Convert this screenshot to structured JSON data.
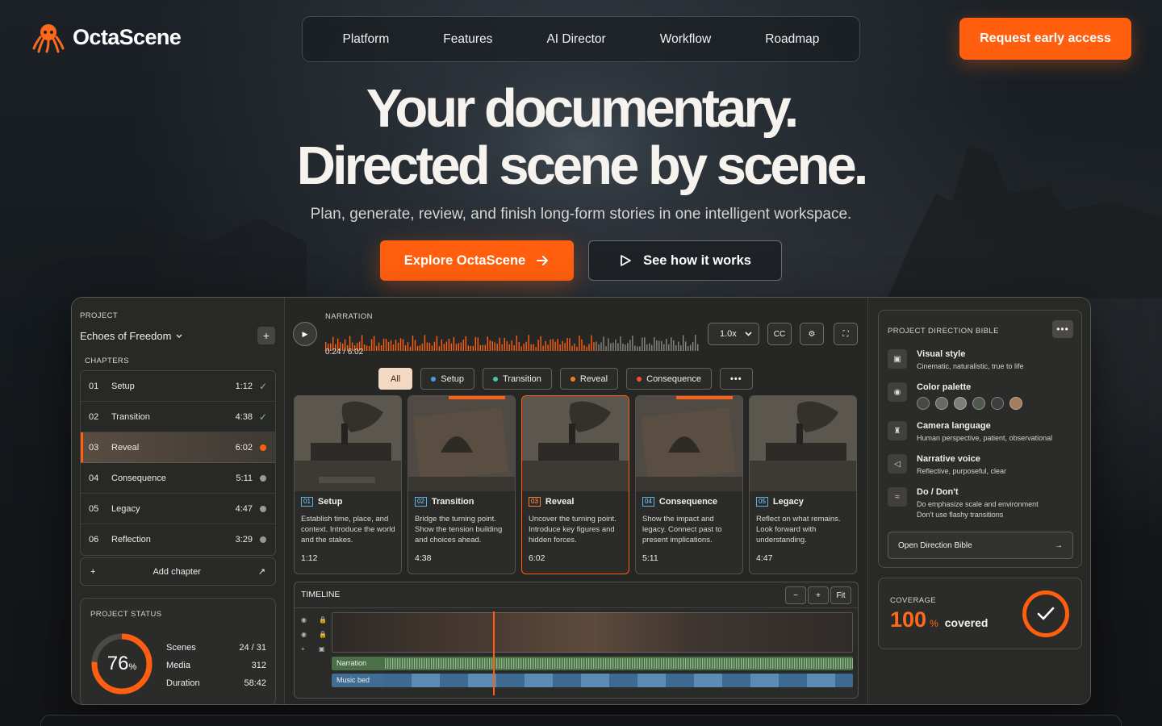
{
  "brand": {
    "name": "OctaScene",
    "accent": "#ff5f0f"
  },
  "nav": {
    "items": [
      "Platform",
      "Features",
      "AI Director",
      "Workflow",
      "Roadmap"
    ]
  },
  "header": {
    "cta_label": "Request early access"
  },
  "hero": {
    "title_line1": "Your documentary.",
    "title_line2": "Directed scene by scene.",
    "subtitle": "Plan, generate, review, and finish long-form stories in one intelligent workspace.",
    "primary_label": "Explore OctaScene",
    "secondary_label": "See how it works"
  },
  "project": {
    "label": "PROJECT",
    "name": "Echoes of Freedom",
    "chapters_label": "CHAPTERS",
    "chapters": [
      {
        "num": "01",
        "name": "Setup",
        "duration": "1:12",
        "status": "done"
      },
      {
        "num": "02",
        "name": "Transition",
        "duration": "4:38",
        "status": "done"
      },
      {
        "num": "03",
        "name": "Reveal",
        "duration": "6:02",
        "status": "active"
      },
      {
        "num": "04",
        "name": "Consequence",
        "duration": "5:11",
        "status": "pending"
      },
      {
        "num": "05",
        "name": "Legacy",
        "duration": "4:47",
        "status": "pending"
      },
      {
        "num": "06",
        "name": "Reflection",
        "duration": "3:29",
        "status": "pending"
      }
    ],
    "add_chapter_label": "Add chapter"
  },
  "status": {
    "label": "PROJECT STATUS",
    "percent": 76,
    "percent_display": "76",
    "percent_symbol": "%",
    "rows": [
      {
        "label": "Scenes",
        "value": "24 / 31"
      },
      {
        "label": "Media",
        "value": "312"
      },
      {
        "label": "Duration",
        "value": "58:42"
      }
    ]
  },
  "narration": {
    "label": "NARRATION",
    "time": "0:24 / 6:02",
    "progress": 0.72,
    "speed": "1.0x",
    "cc_label": "CC"
  },
  "filters": [
    {
      "label": "All",
      "color": "",
      "active": true
    },
    {
      "label": "Setup",
      "color": "#4a9be0",
      "active": false
    },
    {
      "label": "Transition",
      "color": "#4fc1b3",
      "active": false
    },
    {
      "label": "Reveal",
      "color": "#ff7a1a",
      "active": false
    },
    {
      "label": "Consequence",
      "color": "#ff4a3a",
      "active": false
    }
  ],
  "scenes": [
    {
      "num": "01",
      "title": "Setup",
      "desc": "Establish time, place, and context. Introduce the world and the stakes.",
      "duration": "1:12"
    },
    {
      "num": "02",
      "title": "Transition",
      "desc": "Bridge the turning point. Show the tension building and choices ahead.",
      "duration": "4:38"
    },
    {
      "num": "03",
      "title": "Reveal",
      "desc": "Uncover the turning point. Introduce key figures and hidden forces.",
      "duration": "6:02"
    },
    {
      "num": "04",
      "title": "Consequence",
      "desc": "Show the impact and legacy. Connect past to present implications.",
      "duration": "5:11"
    },
    {
      "num": "05",
      "title": "Legacy",
      "desc": "Reflect on what remains. Look forward with understanding.",
      "duration": "4:47"
    }
  ],
  "timeline": {
    "label": "TIMELINE",
    "zoom_out": "−",
    "zoom_in": "+",
    "fit": "Fit",
    "narration_track": "Narration",
    "music_track": "Music bed"
  },
  "bible": {
    "label": "PROJECT DIRECTION BIBLE",
    "items": [
      {
        "title": "Visual style",
        "desc": "Cinematic, naturalistic, true to life",
        "icon": "frame-icon"
      },
      {
        "title": "Color palette",
        "desc": "",
        "icon": "palette-icon"
      },
      {
        "title": "Camera language",
        "desc": "Human perspective, patient, observational",
        "icon": "camera-icon"
      },
      {
        "title": "Narrative voice",
        "desc": "Reflective, purposeful, clear",
        "icon": "voice-icon"
      },
      {
        "title": "Do / Don't",
        "desc": "Do emphasize scale and environment",
        "desc2": "Don't use flashy transitions",
        "icon": "rules-icon"
      }
    ],
    "palette": [
      "#4a4844",
      "#6a6864",
      "#7e7d79",
      "#4f5a4d",
      "#3b3e3c",
      "#a47c5e"
    ],
    "open_label": "Open Direction Bible"
  },
  "coverage": {
    "label": "COVERAGE",
    "value": "100",
    "unit": "%",
    "text": "covered"
  }
}
